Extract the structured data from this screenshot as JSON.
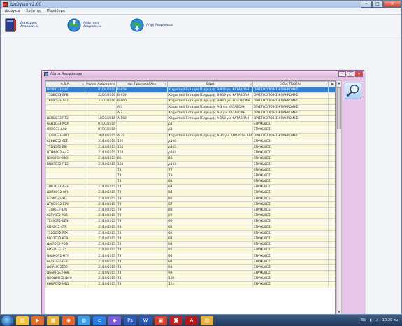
{
  "window": {
    "title": "Διαύγεια v2.00",
    "minimize": "–",
    "maximize": "□",
    "close": "✕"
  },
  "menu": [
    "Διαύγεια",
    "Χρήστης",
    "Παράθυρα"
  ],
  "toolbar": [
    {
      "label": "Διαχείριση Αποφάσεων",
      "icon": "book-icon"
    },
    {
      "label": "Ανάρτηση Αποφάσεων",
      "icon": "globe-upload-icon"
    },
    {
      "label": "Λήψη Αποφάσεων",
      "icon": "globe-download-icon"
    }
  ],
  "child": {
    "title": "Λίστα Αποφάσεων",
    "minimize": "–",
    "maximize": "□",
    "close": "✕"
  },
  "columns": [
    "Α.Δ.Α.",
    "Ημ/νία Ανάρτησης",
    "Αρ. Πρωτοκόλλου",
    "Θέμα",
    "Είδος Πράξης"
  ],
  "rows": [
    [
      "ΟΚΒΡΟΞ3-ΩΛΟ",
      "07/04/2016",
      "Β-958",
      "Χρηματικό Ένταλμα Πληρωμής Β-958 για  ΚΑΤΑΒΟΛΗ",
      "ΟΡΙΣΤΙΚΟΠΟΙΗΣΗ ΠΛΗΡΩΜΗΣ"
    ],
    [
      "77ΩΒΟΞ3-ΒΡ8",
      "22/03/2016",
      "Β-959",
      "Χρηματικό Ένταλμα Πληρωμής Β-959 για  ΚΑΤΑΒΟΛΗ",
      "ΟΡΙΣΤΙΚΟΠΟΙΗΣΗ ΠΛΗΡΩΜΗΣ"
    ],
    [
      "7Κ6ΒΟΞ3-77Ω",
      "22/03/2016",
      "Β-960",
      "Χρηματικό Ένταλμα Πληρωμής Β-960 για  ΕΠΙΣΤΡΟΦΗ",
      "ΟΡΙΣΤΙΚΟΠΟΙΗΣΗ ΠΛΗΡΩΜΗΣ"
    ],
    [
      "",
      "",
      "Α-3",
      "Χρηματικό Ένταλμα Πληρωμής Α-3 για  ΚΑΤΑΒΟΛΗ",
      "ΟΡΙΣΤΙΚΟΠΟΙΗΣΗ ΠΛΗΡΩΜΗΣ"
    ],
    [
      "",
      "",
      "Α-2",
      "Χρηματικό Ένταλμα Πληρωμής Α-2 για  ΚΑΤΑΒΟΛΗ",
      "ΟΡΙΣΤΙΚΟΠΟΙΗΣΗ ΠΛΗΡΩΜΗΣ"
    ],
    [
      "Ω6ΒΒΟΞ3-ΠΤ2",
      "18/03/2016",
      "Α-158",
      "Χρηματικό Ένταλμα Πληρωμής Α-158 για  ΚΑΤΑΒΟΛΗ",
      "ΟΡΙΣΤΙΚΟΠΟΙΗΣΗ ΠΛΗΡΩΜΗΣ"
    ],
    [
      "6ΑΗ1ΟΞ3-Ν6Χ",
      "07/03/2016",
      "",
      "ρ3",
      "ΕΓΚΥΚΛΙΟΣ"
    ],
    [
      "ΟΙΟΙΟΞ3-ΔΑΦ",
      "07/03/2016",
      "",
      "ρ1",
      "ΕΓΚΥΚΛΙΟΣ"
    ],
    [
      "7Χ4ΗΟΞ3-3ΑΩ",
      "26/10/2015",
      "Α-35",
      "Χρηματικό Ένταλμα Πληρωμής Α-35 για  ΑΠΟΔΟΣΗ ΚΡΑ",
      "ΟΡΙΣΤΙΚΟΠΟΙΗΣΗ ΠΛΗΡΩΜΗΣ"
    ],
    [
      "6Σ6ΦΟΞ2-6ΣΣ",
      "21/10/2015",
      "106",
      "ρ106",
      "ΕΓΚΥΚΛΙΟΣ"
    ],
    [
      "7Τ2ΝΟΞ2-Ζ9Ι",
      "21/10/2015",
      "105",
      "ρ105",
      "ΕΓΚΥΚΛΙΟΣ"
    ],
    [
      "ΩΤΗΦΟΞ2-Α4Ξ",
      "21/10/2015",
      "104",
      "ρ104",
      "ΕΓΚΥΚΛΙΟΣ"
    ],
    [
      "Ν2ΙΚΟΞ2-ΘΦΟ",
      "21/10/2015",
      "85",
      "85",
      "ΕΓΚΥΚΛΙΟΣ"
    ],
    [
      "ΒΝΗΓΟΞ2-ΠΣ2",
      "21/10/2015",
      "103",
      "ρ103",
      "ΕΓΚΥΚΛΙΟΣ"
    ],
    [
      "",
      "",
      "74",
      "77",
      "ΕΓΚΥΚΛΙΟΣ"
    ],
    [
      "",
      "",
      "74",
      "79",
      "ΕΓΚΥΚΛΙΟΣ"
    ],
    [
      "",
      "",
      "74",
      "81",
      "ΕΓΚΥΚΛΙΟΣ"
    ],
    [
      "7ΘΒ3ΟΞ2-ΑΞ3",
      "21/10/2015",
      "74",
      "83",
      "ΕΓΚΥΚΛΙΟΣ"
    ],
    [
      "ΩΒΠΚΟΞ2-ΦΡΗ",
      "21/10/2015",
      "74",
      "84",
      "ΕΓΚΥΚΛΙΟΣ"
    ],
    [
      "6Τ4ΦΟΞ2-ΧΓΙ",
      "21/10/2015",
      "74",
      "86",
      "ΕΓΚΥΚΛΙΟΣ"
    ],
    [
      "ΩΤΘΒΟΞ2-Ε8Ψ",
      "21/10/2015",
      "74",
      "87",
      "ΕΓΚΥΚΛΙΟΣ"
    ],
    [
      "73ΙΘΟΞ2-42Ο",
      "21/10/2015",
      "74",
      "88",
      "ΕΓΚΥΚΛΙΟΣ"
    ],
    [
      "6Ζ1ΥΟΞ2-Λ36",
      "21/10/2015",
      "74",
      "89",
      "ΕΓΚΥΚΛΙΟΣ"
    ],
    [
      "7Ζ49ΟΞ2-1ΖΝ",
      "21/10/2015",
      "74",
      "90",
      "ΕΓΚΥΚΛΙΟΣ"
    ],
    [
      "6Ι2ΛΟΞ2-6ΤΝ",
      "21/10/2015",
      "74",
      "91",
      "ΕΓΚΥΚΛΙΟΣ"
    ],
    [
      "732ΩΟΞ2-ΡΞΧ",
      "21/10/2015",
      "74",
      "92",
      "ΕΓΚΥΚΛΙΟΣ"
    ],
    [
      "6Ω23ΟΞ2-ΚΞ9",
      "21/10/2015",
      "74",
      "93",
      "ΕΓΚΥΚΛΙΟΣ"
    ],
    [
      "ΩΑΙ7ΟΞ2-7ΟΘ",
      "21/10/2015",
      "74",
      "94",
      "ΕΓΚΥΚΛΙΟΣ"
    ],
    [
      "6Ι4ΕΟΞ2-3Ζ5",
      "21/10/2015",
      "74",
      "95",
      "ΕΓΚΥΚΛΙΟΣ"
    ],
    [
      "Ν98ΜΟΞ2-Η7Υ",
      "21/10/2015",
      "74",
      "96",
      "ΕΓΚΥΚΛΙΟΣ"
    ],
    [
      "6Α5ΕΟΞ2-ΣΞ8",
      "21/10/2015",
      "74",
      "97",
      "ΕΓΚΥΚΛΙΟΣ"
    ],
    [
      "ΩΟΨ4ΟΞ2Ε99",
      "21/10/2015",
      "74",
      "98",
      "ΕΓΚΥΚΛΙΟΣ"
    ],
    [
      "Ν6ΑΡΤΟΞ2-98Ε",
      "21/10/2015",
      "74",
      "99",
      "ΕΓΚΥΚΛΙΟΣ"
    ],
    [
      "ΝΗΘΩΡΟΞ2-ΝΗΦ",
      "21/10/2015",
      "74",
      "100",
      "ΕΓΚΥΚΛΙΟΣ"
    ],
    [
      "6ΘΒΡΟΞ2-ΝΕΩ",
      "21/10/2015",
      "74",
      "101",
      "ΕΓΚΥΚΛΙΟΣ"
    ]
  ],
  "selected_row": 0,
  "taskbar": {
    "apps": [
      "explorer-icon",
      "media-icon",
      "folder-icon",
      "firefox-icon",
      "chrome-icon",
      "ie-icon",
      "app-icon",
      "ps-icon",
      "word-icon",
      "diavgeia-icon",
      "pdf-icon",
      "acrobat-icon",
      "explorer2-icon"
    ],
    "lang": "EN",
    "time": "10:29 πμ"
  }
}
